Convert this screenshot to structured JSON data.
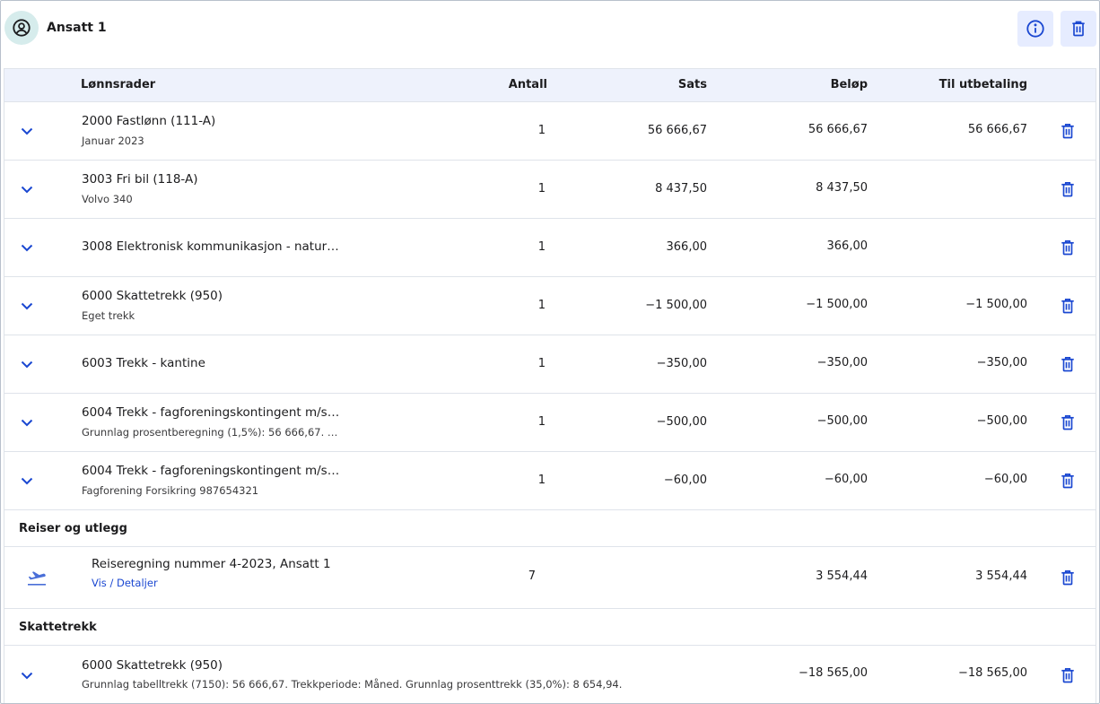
{
  "header": {
    "employee_name": "Ansatt 1",
    "avatar_icon": "user-circle-icon",
    "info_icon": "info-icon",
    "delete_icon": "trash-icon"
  },
  "columns": {
    "lines": "Lønnsrader",
    "count": "Antall",
    "rate": "Sats",
    "amount": "Beløp",
    "payout": "Til utbetaling"
  },
  "rows": [
    {
      "title": "2000 Fastlønn (111-A)",
      "subtitle": "Januar 2023",
      "count": "1",
      "rate": "56 666,67",
      "amount": "56 666,67",
      "payout": "56 666,67"
    },
    {
      "title": "3003 Fri bil (118-A)",
      "subtitle": "Volvo 340",
      "count": "1",
      "rate": "8 437,50",
      "amount": "8 437,50",
      "payout": ""
    },
    {
      "title": "3008 Elektronisk kommunikasjon - natur…",
      "subtitle": "",
      "count": "1",
      "rate": "366,00",
      "amount": "366,00",
      "payout": ""
    },
    {
      "title": "6000 Skattetrekk (950)",
      "subtitle": "Eget trekk",
      "count": "1",
      "rate": "−1 500,00",
      "amount": "−1 500,00",
      "payout": "−1 500,00"
    },
    {
      "title": "6003 Trekk - kantine",
      "subtitle": "",
      "count": "1",
      "rate": "−350,00",
      "amount": "−350,00",
      "payout": "−350,00"
    },
    {
      "title": "6004 Trekk - fagforeningskontingent m/s…",
      "subtitle": "Grunnlag prosentberegning (1,5%): 56 666,67. …",
      "count": "1",
      "rate": "−500,00",
      "amount": "−500,00",
      "payout": "−500,00"
    },
    {
      "title": "6004 Trekk - fagforeningskontingent m/s…",
      "subtitle": "Fagforening Forsikring 987654321",
      "count": "1",
      "rate": "−60,00",
      "amount": "−60,00",
      "payout": "−60,00"
    }
  ],
  "travel_section": {
    "heading": "Reiser og utlegg",
    "icon": "airplane-takeoff-icon",
    "title": "Reiseregning nummer 4-2023, Ansatt 1",
    "link": "Vis / Detaljer",
    "count": "7",
    "amount": "3 554,44",
    "payout": "3 554,44"
  },
  "tax_section": {
    "heading": "Skattetrekk",
    "title": "6000 Skattetrekk (950)",
    "subtitle": "Grunnlag tabelltrekk (7150): 56 666,67. Trekkperiode: Måned. Grunnlag prosenttrekk (35,0%): 8 654,94.",
    "amount": "−18 565,00",
    "payout": "−18 565,00"
  },
  "colors": {
    "accent": "#1a47d1",
    "header_bg": "#eef2fc",
    "button_bg": "#e6ecff",
    "avatar_bg": "#d6ecec"
  }
}
